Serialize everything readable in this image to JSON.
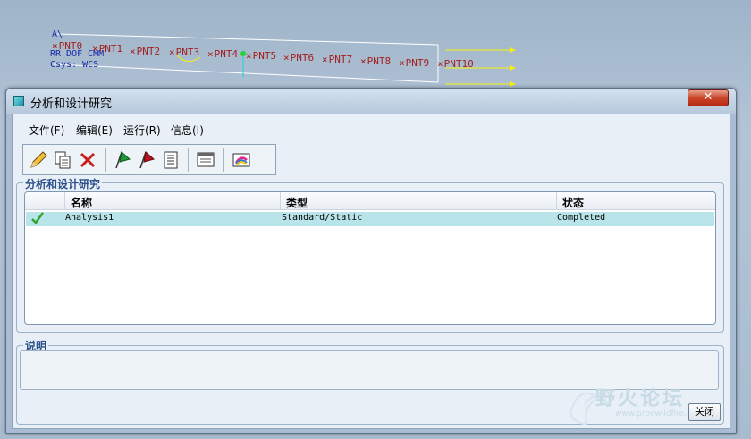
{
  "viewport": {
    "csys_labels": [
      "A\\",
      "RR DOF CMM",
      "Csys: WCS"
    ],
    "points": [
      "PNT0",
      "PNT1",
      "PNT2",
      "PNT3",
      "PNT4",
      "PNT5",
      "PNT6",
      "PNT7",
      "PNT8",
      "PNT9",
      "PNT10"
    ]
  },
  "window": {
    "title": "分析和设计研究",
    "close_glyph": "✕"
  },
  "menu": {
    "items": [
      {
        "label": "文件(F)"
      },
      {
        "label": "编辑(E)"
      },
      {
        "label": "运行(R)"
      },
      {
        "label": "信息(I)"
      }
    ]
  },
  "toolbar": {
    "icons": [
      "edit-pencil-icon",
      "copy-icon",
      "delete-icon",
      "run-green-flag-icon",
      "stop-red-flag-icon",
      "status-list-icon",
      "results-display-icon",
      "animation-icon"
    ]
  },
  "studies": {
    "group_label": "分析和设计研究",
    "columns": [
      "名称",
      "类型",
      "状态"
    ],
    "rows": [
      {
        "name": "Analysis1",
        "type": "Standard/Static",
        "status": "Completed"
      }
    ]
  },
  "description": {
    "group_label": "说明",
    "text": ""
  },
  "buttons": {
    "close": "关闭"
  },
  "watermark": {
    "text": "野火论坛",
    "url": "www.proewildfire.cn"
  },
  "colors": {
    "selected_row": "#b9e4ea",
    "check": "#2fa52f",
    "close_button": "#c9452a"
  }
}
